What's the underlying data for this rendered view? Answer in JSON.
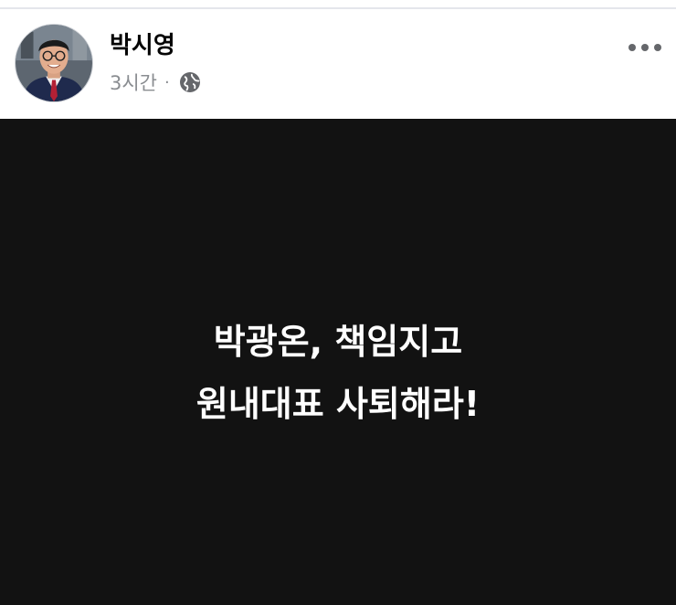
{
  "post": {
    "author": "박시영",
    "time": "3시간",
    "separator": "·",
    "privacy_icon": "globe-icon",
    "more_icon": "more-options-icon",
    "image_text": {
      "line1": "박광온, 책임지고",
      "line2": "원내대표 사퇴해라!"
    },
    "image_background": "#121212"
  }
}
